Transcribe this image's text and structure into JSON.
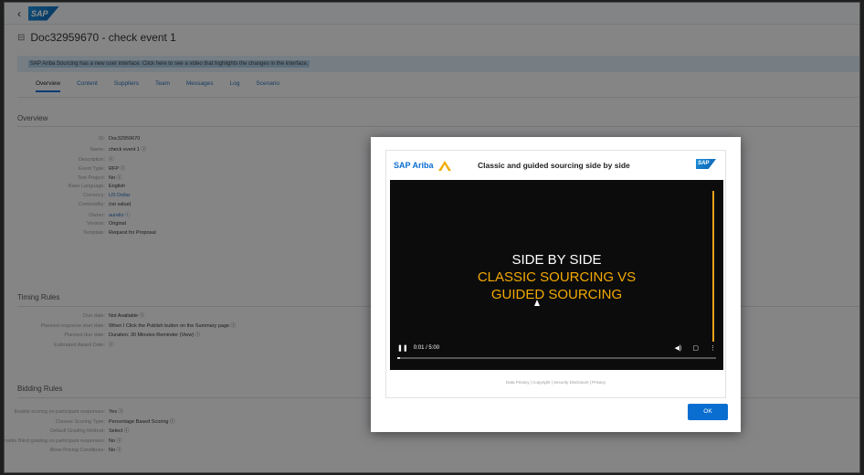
{
  "shell": {
    "back": "‹",
    "logo": "SAP"
  },
  "title": "Doc32959670 - check event 1",
  "banner": "SAP Ariba Sourcing has a new user interface. Click here to see a video that highlights the changes in the interface.",
  "tabs": [
    "Overview",
    "Content",
    "Suppliers",
    "Team",
    "Messages",
    "Log",
    "Scenario"
  ],
  "active_tab": 0,
  "sections": {
    "overview": "Overview",
    "timing": "Timing Rules",
    "bidding": "Bidding Rules"
  },
  "overview_fields": [
    {
      "label": "ID:",
      "value": "Doc32959670",
      "link": false
    },
    {
      "label": "Name:",
      "value": "check event 1 ⓘ",
      "link": false
    },
    {
      "label": "Description:",
      "value": "ⓘ",
      "link": false
    },
    {
      "label": "Event Type:",
      "value": "RFP ⓘ",
      "link": false
    },
    {
      "label": "Test Project:",
      "value": "No ⓘ",
      "link": false
    },
    {
      "label": "Base Language:",
      "value": "English",
      "link": false
    },
    {
      "label": "Currency:",
      "value": "US Dollar",
      "link": true
    },
    {
      "label": "Commodity:",
      "value": "(no value)",
      "link": false
    },
    {
      "label": "Owner:",
      "value": "aurelio ⓘ",
      "link": true
    },
    {
      "label": "Version:",
      "value": "Original",
      "link": false
    },
    {
      "label": "Template:",
      "value": "Request for Proposal",
      "link": false
    }
  ],
  "timing_fields": [
    {
      "label": "Due date:",
      "value": "Not Available ⓘ"
    },
    {
      "label": "Planned response start date:",
      "value": "When I Click the Publish button on the Summary page ⓘ"
    },
    {
      "label": "Planned due date:",
      "value": "Duration: 30 Minutes      Reminder (View) ⓘ"
    },
    {
      "label": "Estimated Award Date:",
      "value": "ⓘ"
    }
  ],
  "bidding_fields": [
    {
      "label": "Enable scoring on participant responses:",
      "value": "Yes ⓘ"
    },
    {
      "label": "Choose Scoring Type:",
      "value": "Percentage Based Scoring ⓘ"
    },
    {
      "label": "Default Grading Method:",
      "value": "Select ⓘ"
    },
    {
      "label": "Enable Blind grading on participant responses:",
      "value": "No ⓘ"
    },
    {
      "label": "Allow Pricing Conditions:",
      "value": "No ⓘ"
    }
  ],
  "modal": {
    "brand": "SAP Ariba",
    "title": "Classic and guided sourcing side by side",
    "sap_logo": "SAP",
    "video": {
      "line1": "SIDE BY SIDE",
      "line2": "CLASSIC SOURCING VS",
      "line3": "GUIDED SOURCING",
      "time": "0:01 / 5:00",
      "pause_icon": "❚❚",
      "volume_icon": "◀)",
      "cc_icon": "▢",
      "more_icon": "⋮",
      "progress": 0.01
    },
    "footer": "Data Privacy | Copyright | Security Disclosure | Privacy",
    "ok_label": "OK"
  },
  "colors": {
    "accent": "#0a6ed1",
    "video_orange": "#f2a900"
  }
}
